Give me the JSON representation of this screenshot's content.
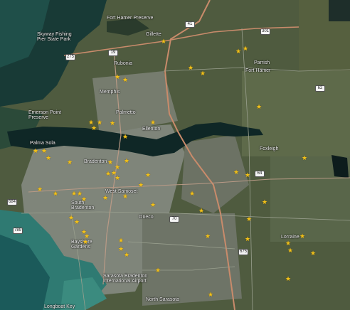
{
  "map": {
    "labels": {
      "fort_hamer": "Fort Hamer Preserve",
      "gillette": "Gillette",
      "skyway_park": "Skyway Fishing Pier State Park",
      "parrish": "Parrish",
      "fort_hamer_2": "Fort Hamer",
      "rubonia": "Rubonia",
      "memphis": "Memphis",
      "palmetto": "Palmetto",
      "emerson": "Emerson Point Preserve",
      "ellenton": "Ellenton",
      "palma_sola": "Palma Sola",
      "bradenton": "Bradenton",
      "foxleigh": "Foxleigh",
      "west_samoset": "West Samoset",
      "south_bradenton": "South Bradenton",
      "oneco": "Oneco",
      "bayshore": "Bayshore Gardens",
      "lorraine": "Lorraine",
      "sarasota_airport": "Sarasota Bradenton International Airport",
      "north_sarasota": "North Sarasota",
      "longboat": "Longboat Key"
    },
    "routes": {
      "r1": "275",
      "r2": "19",
      "r3": "41",
      "r4": "301",
      "r5": "62",
      "r6": "64",
      "r7": "70",
      "r8": "675",
      "r9": "684",
      "r10": "789"
    },
    "marker_symbol": "★",
    "colors": {
      "marker": "#f2c11a",
      "water": "#0e2a2c",
      "shallow_water": "#2f7a72",
      "land": "#4f5b3f",
      "urban": "#8a8f86",
      "road": "#c98b6b"
    }
  }
}
